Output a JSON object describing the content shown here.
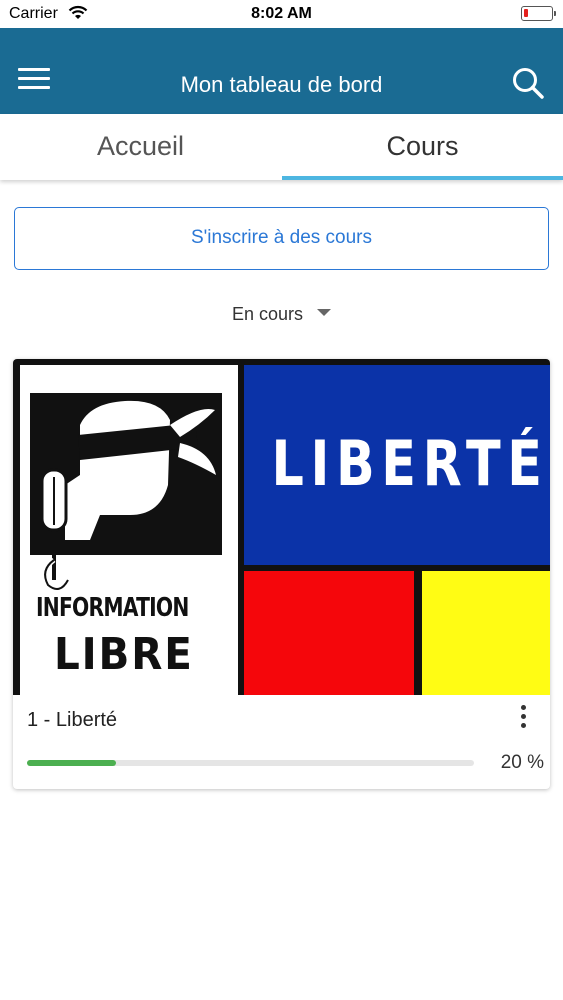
{
  "status_bar": {
    "carrier": "Carrier",
    "time": "8:02 AM",
    "battery_color": "#e5211e"
  },
  "header": {
    "title": "Mon tableau de bord",
    "menu_icon": "hamburger-menu-icon",
    "search_icon": "search-icon",
    "background_color": "#1a6b93"
  },
  "tabs": [
    {
      "label": "Accueil",
      "selected": false
    },
    {
      "label": "Cours",
      "selected": true
    }
  ],
  "enroll_button": {
    "label": "S'inscrire à des cours",
    "color": "#2b78d6"
  },
  "filter": {
    "selected": "En cours"
  },
  "courses": [
    {
      "title": "1 - Liberté",
      "image_text": {
        "banner": "LIBERTÉ",
        "poster_line1": "INFORMATION",
        "poster_line2": "LIBRE"
      },
      "progress": 20,
      "progress_label": "20 %",
      "progress_color": "#4caf50"
    }
  ]
}
